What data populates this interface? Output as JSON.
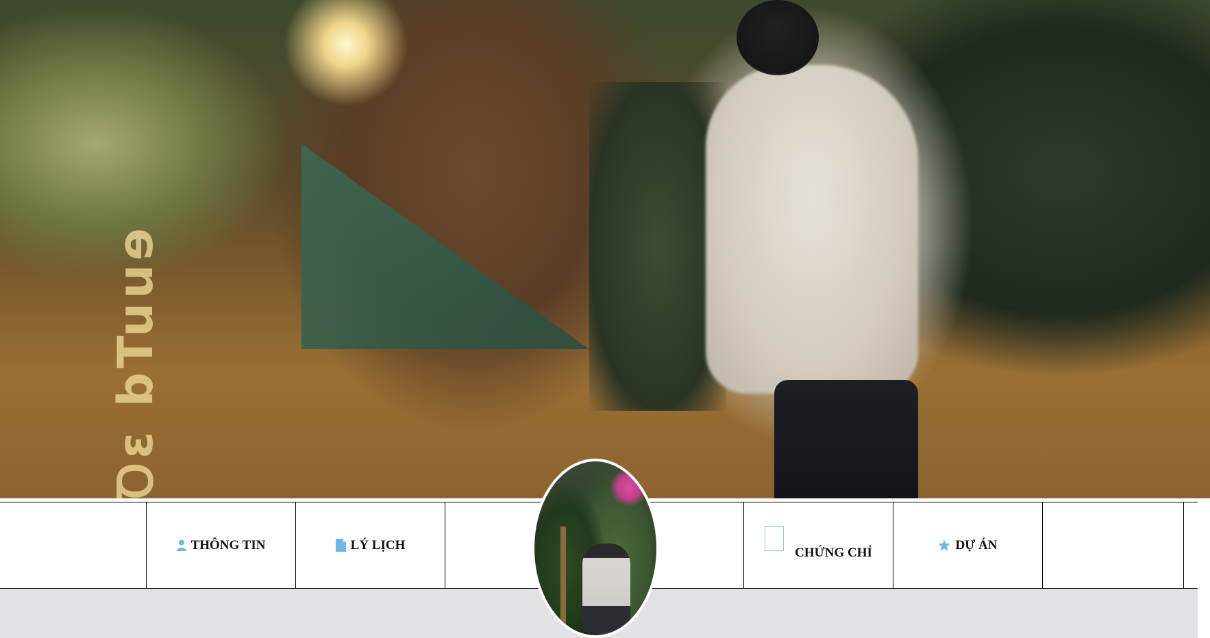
{
  "cover": {
    "overlay_text": "Ꝺε bTuuɘ"
  },
  "nav": {
    "items": [
      {
        "label": "",
        "icon": ""
      },
      {
        "label": "THÔNG TIN",
        "icon": "user-icon"
      },
      {
        "label": "LÝ LỊCH",
        "icon": "document-icon"
      },
      {
        "label": "",
        "icon": ""
      },
      {
        "label": "",
        "icon": ""
      },
      {
        "label": "CHỨNG CHỈ",
        "icon": "certificate-icon"
      },
      {
        "label": "DỰ ÁN",
        "icon": "star-icon"
      },
      {
        "label": "",
        "icon": ""
      }
    ]
  },
  "colors": {
    "icon_accent": "#6cb8e6",
    "content_bg": "#e2e1e3"
  }
}
